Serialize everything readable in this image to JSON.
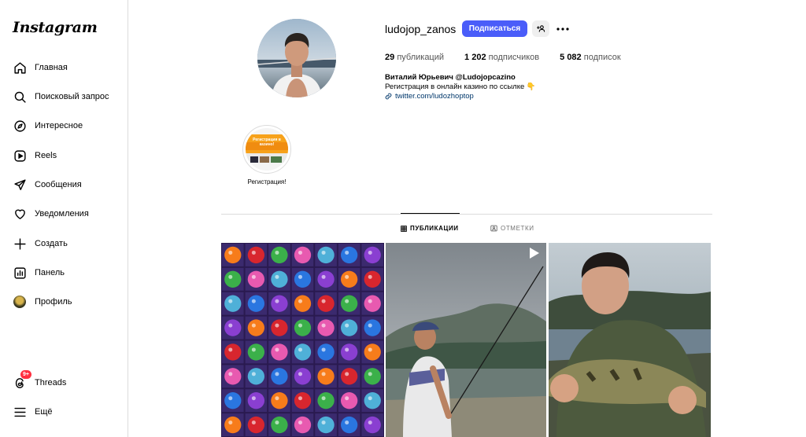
{
  "sidebar": {
    "logo": "Instagram",
    "items": [
      {
        "label": "Главная",
        "icon": "home-icon"
      },
      {
        "label": "Поисковый запрос",
        "icon": "search-icon"
      },
      {
        "label": "Интересное",
        "icon": "compass-icon"
      },
      {
        "label": "Reels",
        "icon": "reels-icon"
      },
      {
        "label": "Сообщения",
        "icon": "messages-icon"
      },
      {
        "label": "Уведомления",
        "icon": "heart-icon"
      },
      {
        "label": "Создать",
        "icon": "plus-icon"
      },
      {
        "label": "Панель",
        "icon": "dashboard-icon"
      },
      {
        "label": "Профиль",
        "icon": "avatar"
      }
    ],
    "threads": {
      "label": "Threads",
      "badge": "9+"
    },
    "more": {
      "label": "Ещё"
    }
  },
  "profile": {
    "username": "ludojop_zanos",
    "follow_label": "Подписаться",
    "stats": {
      "posts_count": "29",
      "posts_unit": "публикаций",
      "followers_count": "1 202",
      "followers_unit": "подписчиков",
      "following_count": "5 082",
      "following_unit": "подписок"
    },
    "full_name": "Виталий Юрьевич @Ludojopcazino",
    "bio": "Регистрация в онлайн казино по ссылке 👇",
    "link": "twitter.com/ludozhoptop"
  },
  "highlights": [
    {
      "label": "Регистрация!",
      "cover_text": "Регистрация в казино!"
    }
  ],
  "tabs": {
    "posts": "ПУБЛИКАЦИИ",
    "tagged": "ОТМЕТКИ"
  },
  "posts": [
    {
      "kind": "image",
      "description_icon": "slot-game"
    },
    {
      "kind": "reel",
      "description_icon": "fishing"
    },
    {
      "kind": "image",
      "description_icon": "fish-catch"
    }
  ],
  "colors": {
    "accent": "#4a5df9",
    "badge": "#ff3040",
    "link": "#00376b",
    "border": "#dbdbdb"
  }
}
